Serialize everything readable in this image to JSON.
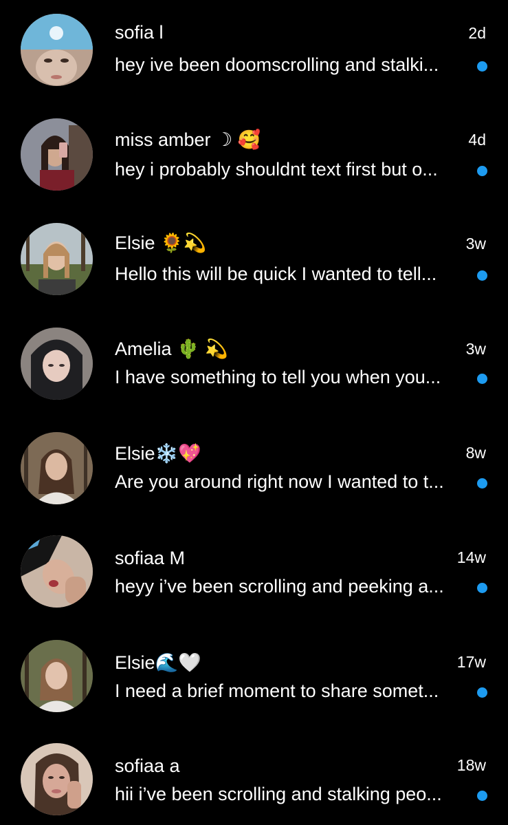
{
  "colors": {
    "background": "#000000",
    "text": "#ffffff",
    "unread_dot": "#1d9bf0"
  },
  "threads": [
    {
      "name": "sofia l",
      "time": "2d",
      "preview": "hey ive been doomscrolling and stalki...",
      "avatar_icon": "person-avatar-icon",
      "unread": true
    },
    {
      "name": "miss amber ☽ 🥰",
      "time": "4d",
      "preview": "hey i probably shouldnt text first but o...",
      "avatar_icon": "person-avatar-icon",
      "unread": true
    },
    {
      "name": "Elsie 🌻💫",
      "time": "3w",
      "preview": "Hello this will be quick I wanted to tell...",
      "avatar_icon": "person-avatar-icon",
      "unread": true
    },
    {
      "name": "Amelia 🌵 💫",
      "time": "3w",
      "preview": "I have something to tell you when you...",
      "avatar_icon": "person-avatar-icon",
      "unread": true
    },
    {
      "name": "Elsie❄️💖",
      "time": "8w",
      "preview": "Are you around right now I wanted to t...",
      "avatar_icon": "person-avatar-icon",
      "unread": true
    },
    {
      "name": "sofiaa M",
      "time": "14w",
      "preview": "heyy i’ve been scrolling and peeking a...",
      "avatar_icon": "person-avatar-icon",
      "unread": true
    },
    {
      "name": "Elsie🌊🤍",
      "time": "17w",
      "preview": "I need a brief moment to share somet...",
      "avatar_icon": "person-avatar-icon",
      "unread": true
    },
    {
      "name": "sofiaa a",
      "time": "18w",
      "preview": "hii i’ve been scrolling and stalking peo...",
      "avatar_icon": "person-avatar-icon",
      "unread": true
    }
  ]
}
